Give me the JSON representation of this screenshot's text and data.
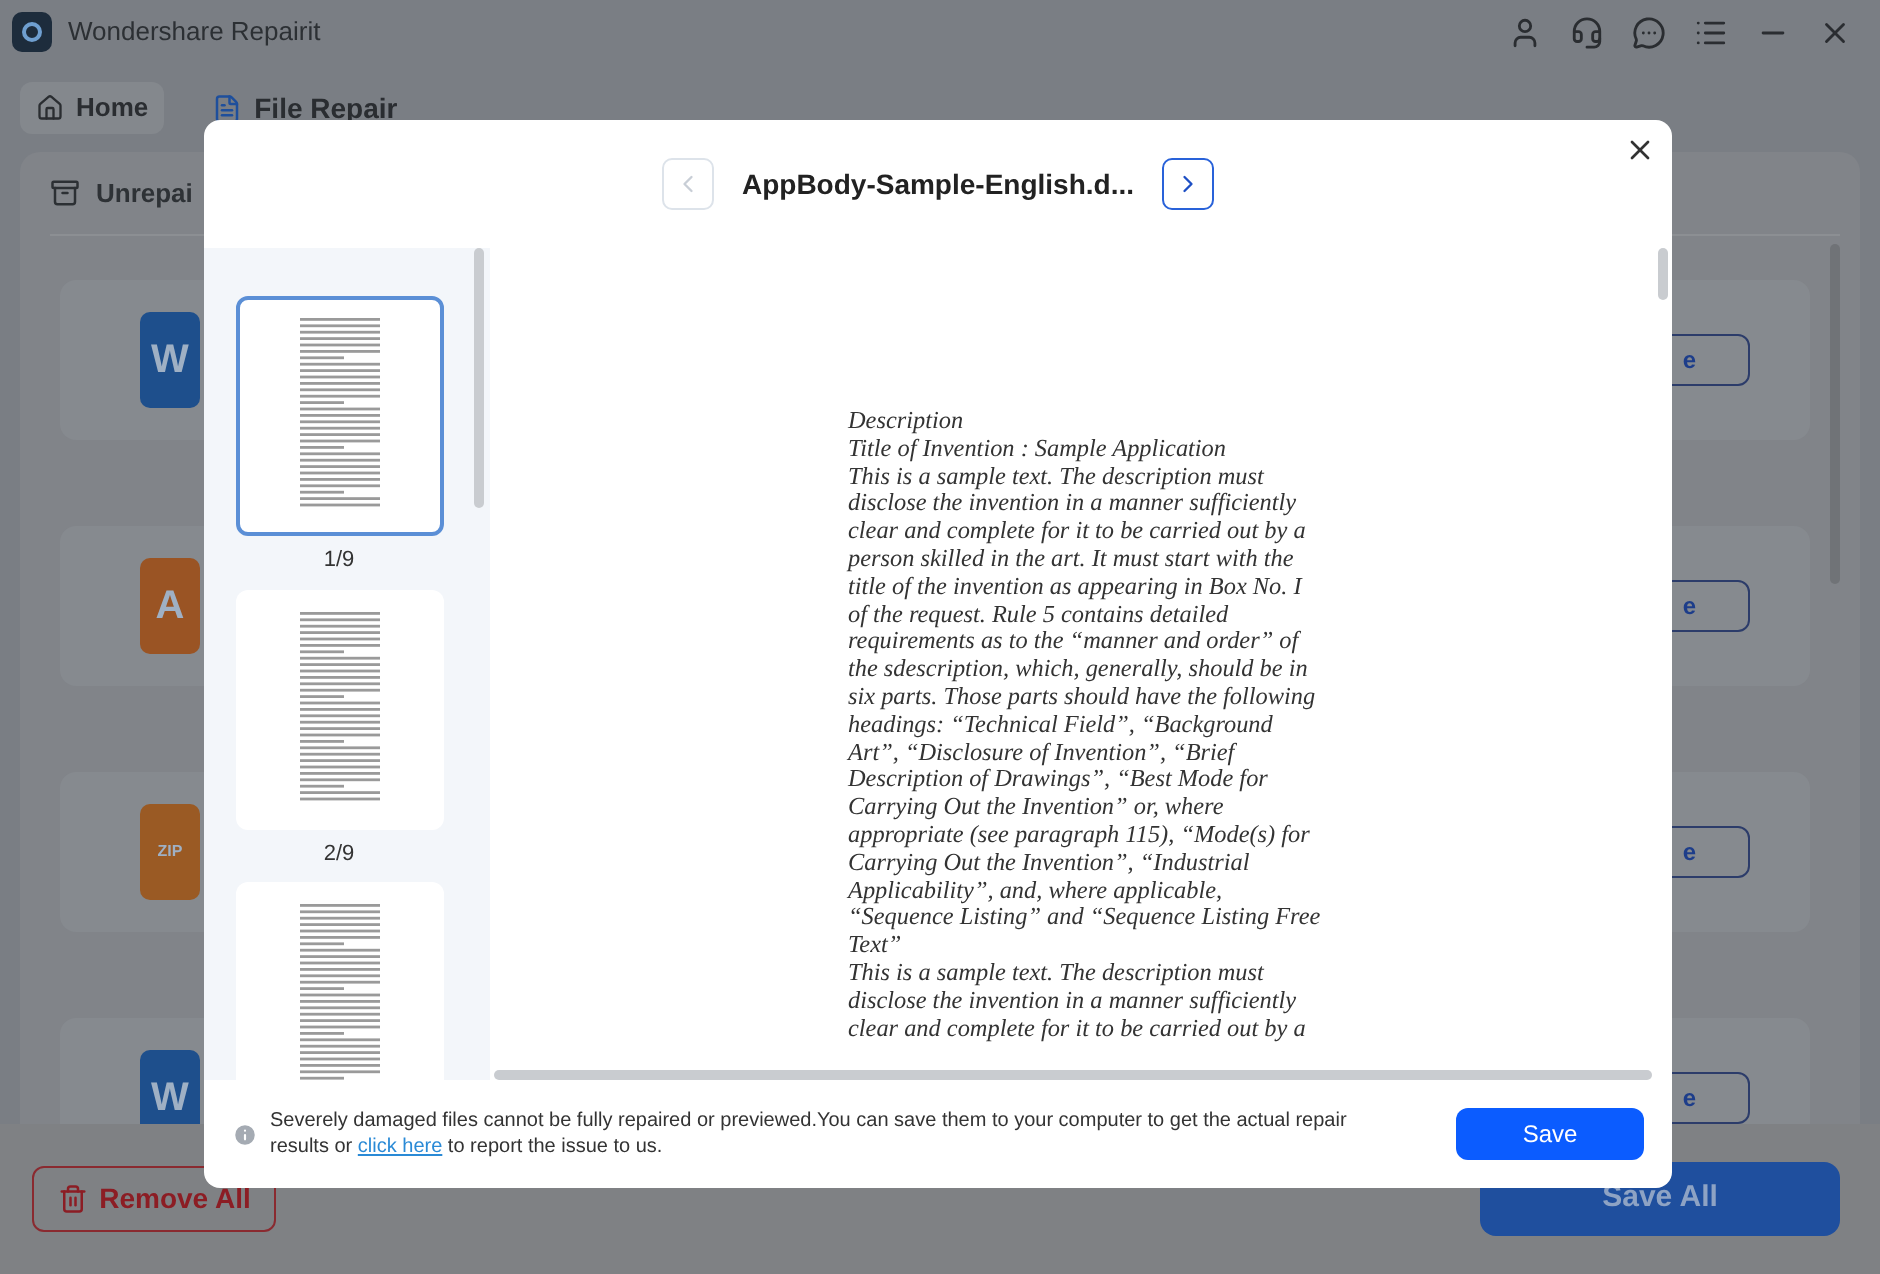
{
  "app": {
    "title": "Wondershare Repairit"
  },
  "tabs": [
    {
      "label": "Home",
      "selected": false
    },
    {
      "label": "File Repair",
      "selected": true
    }
  ],
  "panel": {
    "title": "Unrepai"
  },
  "files": [
    {
      "kind": "word",
      "icon_label": "W",
      "button": "e"
    },
    {
      "kind": "audio",
      "icon_label": "A",
      "button": "e"
    },
    {
      "kind": "zip",
      "icon_label": "ZIP",
      "button": "e"
    },
    {
      "kind": "word",
      "icon_label": "W",
      "button": "e"
    }
  ],
  "bottom": {
    "remove_all": "Remove All",
    "save_all": "Save All"
  },
  "preview": {
    "file_name": "AppBody-Sample-English.d...",
    "prev_disabled": true,
    "next_disabled": false,
    "thumbnails": [
      {
        "label": "1/9",
        "selected": true
      },
      {
        "label": "2/9",
        "selected": false
      },
      {
        "selected": false
      }
    ],
    "paragraphs": [
      "Description",
      "Title of Invention : Sample Application",
      "This is a sample text. The description must disclose the invention in a manner sufficiently clear and complete for it to be carried out by a person skilled in the art. It must start with the title of the invention as appearing in Box No. I of the request. Rule 5 contains detailed requirements as to the “manner and order” of the sdescription, which, generally, should be in six parts. Those parts should have the following headings: “Technical Field”, “Background Art”, “Disclosure of Invention”, “Brief Description of Drawings”, “Best Mode for Carrying Out the Invention” or, where appropriate (see paragraph 115), “Mode(s) for Carrying Out the Invention”, “Industrial Applicability”, and, where applicable, “Sequence Listing” and “Sequence Listing Free Text”",
      "This is a sample text. The description must disclose the invention in a manner sufficiently clear and complete for it to be carried out by a"
    ],
    "notice": {
      "text_before": "Severely damaged files cannot be fully repaired or previewed.You can save them to your computer to get the actual repair results or ",
      "link": "click here",
      "text_after": " to report the issue to us."
    },
    "save": "Save"
  }
}
